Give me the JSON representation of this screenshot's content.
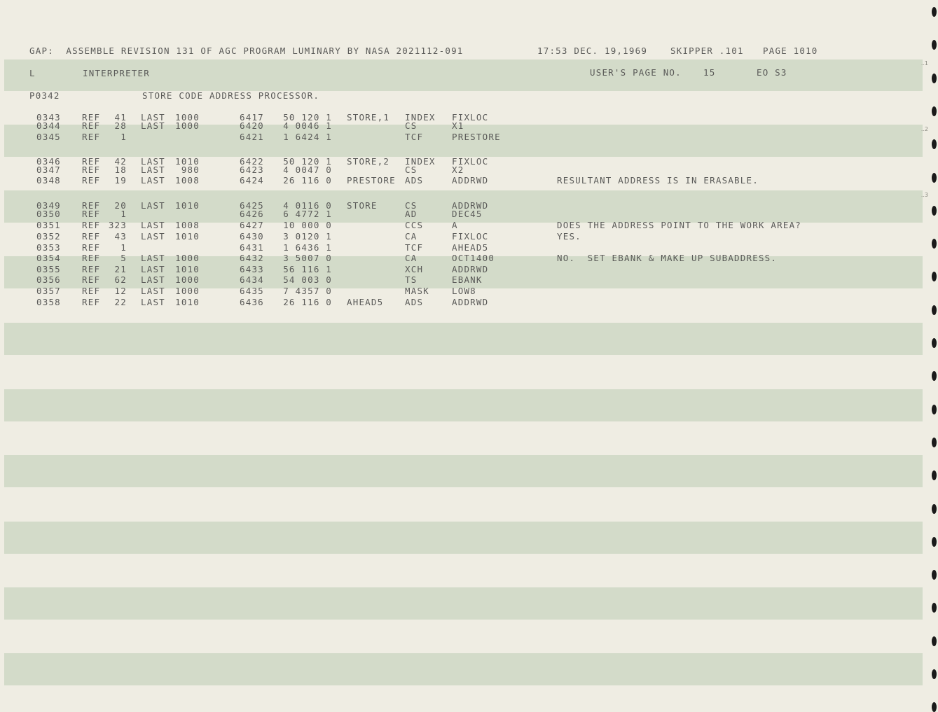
{
  "header": {
    "line": "GAP:  ASSEMBLE REVISION 131 OF AGC PROGRAM LUMINARY BY NASA 2021112-091",
    "timestamp": "17:53 DEC. 19,1969",
    "skipper": "SKIPPER .101",
    "page": "PAGE 1010"
  },
  "section": {
    "letter": "L",
    "name": "INTERPRETER",
    "user_page_label": "USER'S PAGE NO.",
    "user_page_number": "15",
    "eo": "EO S3"
  },
  "subtitle": {
    "page_ref": "P0342",
    "title": "STORE CODE ADDRESS PROCESSOR."
  },
  "rows": [
    {
      "line": "0343",
      "ref": "REF",
      "refnum": "41",
      "last": "LAST",
      "lastnum": "1000",
      "addr": "6417",
      "code": "50 120 1",
      "label": "STORE,1",
      "op": "INDEX",
      "operand": "FIXLOC",
      "comment": ""
    },
    {
      "line": "0344",
      "ref": "REF",
      "refnum": "28",
      "last": "LAST",
      "lastnum": "1000",
      "addr": "6420",
      "code": "4 0046 1",
      "label": "",
      "op": "CS",
      "operand": "X1",
      "comment": ""
    },
    {
      "line": "0345",
      "ref": "REF",
      "refnum": "1",
      "last": "",
      "lastnum": "",
      "addr": "6421",
      "code": "1 6424 1",
      "label": "",
      "op": "TCF",
      "operand": "PRESTORE",
      "comment": ""
    },
    {
      "line": "0346",
      "ref": "REF",
      "refnum": "42",
      "last": "LAST",
      "lastnum": "1010",
      "addr": "6422",
      "code": "50 120 1",
      "label": "STORE,2",
      "op": "INDEX",
      "operand": "FIXLOC",
      "comment": ""
    },
    {
      "line": "0347",
      "ref": "REF",
      "refnum": "18",
      "last": "LAST",
      "lastnum": "980",
      "addr": "6423",
      "code": "4 0047 0",
      "label": "",
      "op": "CS",
      "operand": "X2",
      "comment": ""
    },
    {
      "line": "0348",
      "ref": "REF",
      "refnum": "19",
      "last": "LAST",
      "lastnum": "1008",
      "addr": "6424",
      "code": "26 116 0",
      "label": "PRESTORE",
      "op": "ADS",
      "operand": "ADDRWD",
      "comment": "RESULTANT ADDRESS IS IN ERASABLE."
    },
    {
      "line": "0349",
      "ref": "REF",
      "refnum": "20",
      "last": "LAST",
      "lastnum": "1010",
      "addr": "6425",
      "code": "4 0116 0",
      "label": "STORE",
      "op": "CS",
      "operand": "ADDRWD",
      "comment": ""
    },
    {
      "line": "0350",
      "ref": "REF",
      "refnum": "1",
      "last": "",
      "lastnum": "",
      "addr": "6426",
      "code": "6 4772 1",
      "label": "",
      "op": "AD",
      "operand": "DEC45",
      "comment": ""
    },
    {
      "line": "0351",
      "ref": "REF",
      "refnum": "323",
      "last": "LAST",
      "lastnum": "1008",
      "addr": "6427",
      "code": "10 000 0",
      "label": "",
      "op": "CCS",
      "operand": "A",
      "comment": "DOES THE ADDRESS POINT TO THE WORK AREA?"
    },
    {
      "line": "0352",
      "ref": "REF",
      "refnum": "43",
      "last": "LAST",
      "lastnum": "1010",
      "addr": "6430",
      "code": "3 0120 1",
      "label": "",
      "op": "CA",
      "operand": "FIXLOC",
      "comment": "YES."
    },
    {
      "line": "0353",
      "ref": "REF",
      "refnum": "1",
      "last": "",
      "lastnum": "",
      "addr": "6431",
      "code": "1 6436 1",
      "label": "",
      "op": "TCF",
      "operand": "AHEAD5",
      "comment": ""
    },
    {
      "line": "0354",
      "ref": "REF",
      "refnum": "5",
      "last": "LAST",
      "lastnum": "1000",
      "addr": "6432",
      "code": "3 5007 0",
      "label": "",
      "op": "CA",
      "operand": "OCT1400",
      "comment": "NO.  SET EBANK & MAKE UP SUBADDRESS."
    },
    {
      "line": "0355",
      "ref": "REF",
      "refnum": "21",
      "last": "LAST",
      "lastnum": "1010",
      "addr": "6433",
      "code": "56 116 1",
      "label": "",
      "op": "XCH",
      "operand": "ADDRWD",
      "comment": ""
    },
    {
      "line": "0356",
      "ref": "REF",
      "refnum": "62",
      "last": "LAST",
      "lastnum": "1000",
      "addr": "6434",
      "code": "54 003 0",
      "label": "",
      "op": "TS",
      "operand": "EBANK",
      "comment": ""
    },
    {
      "line": "0357",
      "ref": "REF",
      "refnum": "12",
      "last": "LAST",
      "lastnum": "1000",
      "addr": "6435",
      "code": "7 4357 0",
      "label": "",
      "op": "MASK",
      "operand": "LOW8",
      "comment": ""
    },
    {
      "line": "0358",
      "ref": "REF",
      "refnum": "22",
      "last": "LAST",
      "lastnum": "1010",
      "addr": "6436",
      "code": "26 116 0",
      "label": "AHEAD5",
      "op": "ADS",
      "operand": "ADDRWD",
      "comment": ""
    }
  ],
  "margin_marks": [
    "..1",
    "..2",
    "..3"
  ]
}
